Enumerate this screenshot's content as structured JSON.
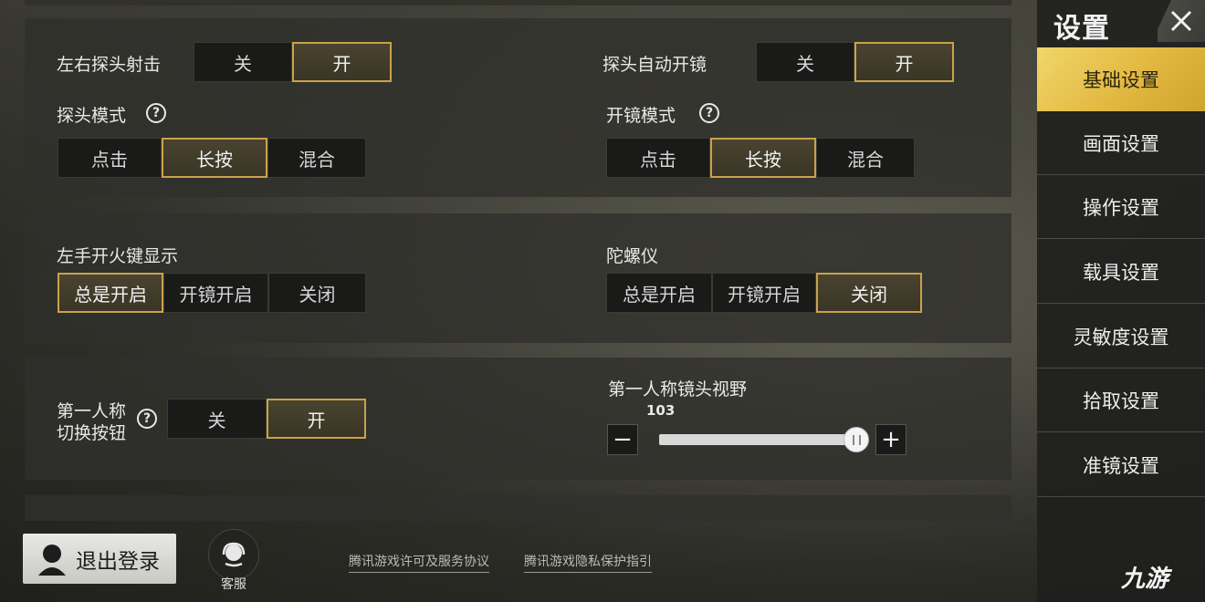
{
  "sidebar": {
    "title": "设置",
    "items": [
      {
        "label": "基础设置",
        "active": true
      },
      {
        "label": "画面设置"
      },
      {
        "label": "操作设置"
      },
      {
        "label": "载具设置"
      },
      {
        "label": "灵敏度设置"
      },
      {
        "label": "拾取设置"
      },
      {
        "label": "准镜设置"
      }
    ]
  },
  "settings": {
    "peek_fire": {
      "label": "左右探头射击",
      "options": [
        "关",
        "开"
      ],
      "selected": "开"
    },
    "peek_auto_scope": {
      "label": "探头自动开镜",
      "options": [
        "关",
        "开"
      ],
      "selected": "开"
    },
    "peek_mode": {
      "label": "探头模式",
      "options": [
        "点击",
        "长按",
        "混合"
      ],
      "selected": "长按"
    },
    "scope_mode": {
      "label": "开镜模式",
      "options": [
        "点击",
        "长按",
        "混合"
      ],
      "selected": "长按"
    },
    "left_fire_display": {
      "label": "左手开火键显示",
      "options": [
        "总是开启",
        "开镜开启",
        "关闭"
      ],
      "selected": "总是开启"
    },
    "gyroscope": {
      "label": "陀螺仪",
      "options": [
        "总是开启",
        "开镜开启",
        "关闭"
      ],
      "selected": "关闭"
    },
    "first_person_toggle": {
      "label_line1": "第一人称",
      "label_line2": "切换按钮",
      "options": [
        "关",
        "开"
      ],
      "selected": "开"
    },
    "first_person_fov": {
      "label": "第一人称镜头视野",
      "value": "103",
      "minus": "−",
      "plus": "+",
      "level": 1.0
    }
  },
  "footer": {
    "logout": "退出登录",
    "service": "客服",
    "link1": "腾讯游戏许可及服务协议",
    "link2": "腾讯游戏隐私保护指引"
  },
  "watermark": "九游",
  "colors": {
    "accent": "#c9a24a",
    "sidebar_active": "#e2b840"
  }
}
